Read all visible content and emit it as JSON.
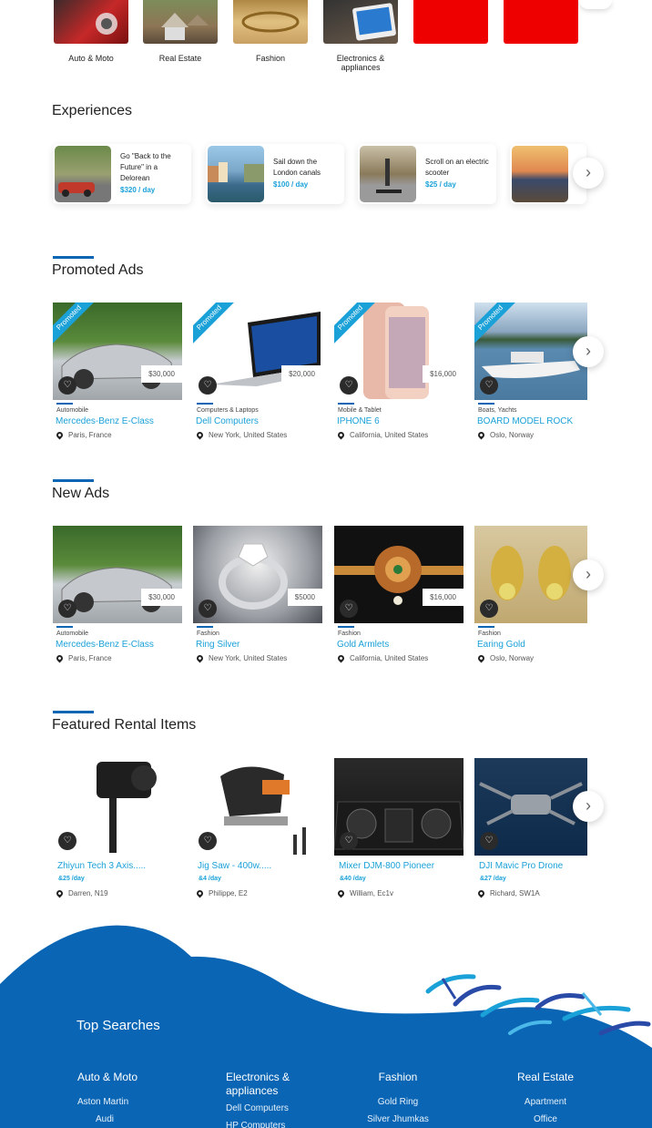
{
  "categories": [
    {
      "label": "Auto & Moto",
      "color": "#c62828"
    },
    {
      "label": "Real Estate",
      "color": "#8d7555"
    },
    {
      "label": "Fashion",
      "color": "#c9a063"
    },
    {
      "label": "Electronics & appliances",
      "color": "#4a4a4a"
    },
    {
      "label": "",
      "color": "#ee0000"
    },
    {
      "label": "",
      "color": "#ee0000"
    }
  ],
  "experiences": {
    "title": "Experiences",
    "items": [
      {
        "text": "Go \"Back to the Future\" in a Delorean",
        "price": "$320 / day"
      },
      {
        "text": "Sail down the London canals",
        "price": "$100 / day"
      },
      {
        "text": "Scroll on an electric scooter",
        "price": "$25 / day"
      },
      {
        "text": "",
        "price": ""
      }
    ]
  },
  "promoted": {
    "title": "Promoted Ads",
    "ribbon": "Promoted",
    "items": [
      {
        "category": "Automobile",
        "title": "Mercedes-Benz E-Class",
        "location": "Paris, France",
        "price": "$30,000"
      },
      {
        "category": "Computers & Laptops",
        "title": "Dell Computers",
        "location": "New York, United States",
        "price": "$20,000"
      },
      {
        "category": "Mobile & Tablet",
        "title": "IPHONE 6",
        "location": "California, United States",
        "price": "$16,000"
      },
      {
        "category": "Boats, Yachts",
        "title": "BOARD MODEL ROCK",
        "location": "Oslo, Norway",
        "price": ""
      }
    ]
  },
  "new_ads": {
    "title": "New Ads",
    "items": [
      {
        "category": "Automobile",
        "title": "Mercedes-Benz E-Class",
        "location": "Paris, France",
        "price": "$30,000"
      },
      {
        "category": "Fashion",
        "title": "Ring Silver",
        "location": "New York, United States",
        "price": "$5000"
      },
      {
        "category": "Fashion",
        "title": "Gold Armlets",
        "location": "California, United States",
        "price": "$16,000"
      },
      {
        "category": "Fashion",
        "title": "Earing Gold",
        "location": "Oslo, Norway",
        "price": ""
      }
    ]
  },
  "rentals": {
    "title": "Featured Rental Items",
    "items": [
      {
        "title": "Zhiyun Tech 3 Axis.....",
        "rate": "&25 /day",
        "location": "Darren, N19"
      },
      {
        "title": "Jig Saw - 400w.....",
        "rate": "&4 /day",
        "location": "Philippe, E2"
      },
      {
        "title": "Mixer DJM-800 Pioneer",
        "rate": "&40 /day",
        "location": "William, Ec1v"
      },
      {
        "title": "DJI Mavic Pro Drone",
        "rate": "&27 /day",
        "location": "Richard, SW1A"
      }
    ]
  },
  "footer": {
    "title": "Top Searches",
    "columns": [
      {
        "head": "Auto & Moto",
        "links": [
          "Aston Martin",
          "Audi"
        ]
      },
      {
        "head": "Electronics & appliances",
        "links": [
          "Dell Computers",
          "HP Computers"
        ]
      },
      {
        "head": "Fashion",
        "links": [
          "Gold Ring",
          "Silver Jhumkas"
        ]
      },
      {
        "head": "Real Estate",
        "links": [
          "Apartment",
          "Office"
        ]
      }
    ]
  },
  "colors": {
    "accent": "#1aa1d8",
    "brand_blue": "#0a66b4"
  }
}
